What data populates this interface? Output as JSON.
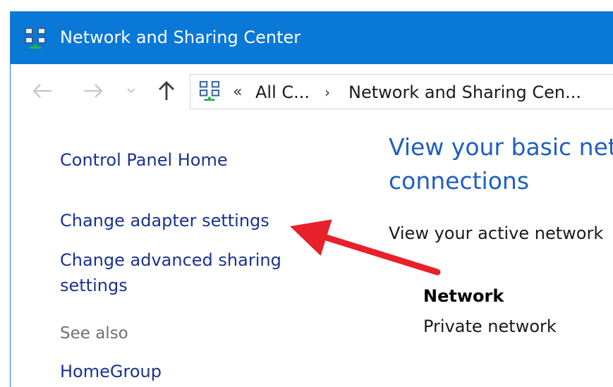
{
  "window": {
    "title": "Network and Sharing Center",
    "icon": "network-icon"
  },
  "navigation": {
    "back_icon": "back-arrow-icon",
    "forward_icon": "forward-arrow-icon",
    "recent_icon": "chevron-down-icon",
    "up_icon": "up-arrow-icon"
  },
  "address_bar": {
    "icon": "network-icon",
    "overflow": "«",
    "segments": [
      "All C...",
      "Network and Sharing Cen..."
    ],
    "separator": "›"
  },
  "sidebar": {
    "links": [
      "Control Panel Home",
      "Change adapter settings",
      "Change advanced sharing",
      "settings"
    ],
    "see_also_label": "See also",
    "see_also_links": [
      "HomeGroup"
    ]
  },
  "main": {
    "heading_line1": "View your basic net",
    "heading_line2": "connections",
    "active_networks_text": "View your active network",
    "network_name": "Network",
    "network_type": "Private network"
  },
  "annotation": {
    "arrow_color": "#e8202a",
    "points_to": "Change adapter settings"
  },
  "colors": {
    "titlebar": "#0a78d7",
    "link": "#1a3290",
    "heading": "#1e5fbf",
    "muted": "#707070"
  }
}
